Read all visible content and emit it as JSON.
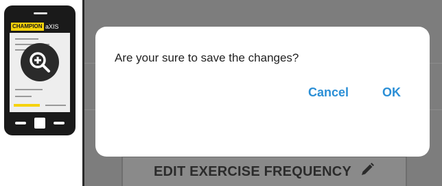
{
  "thumbnail": {
    "brand_primary": "CHAMPION",
    "brand_secondary": "aXIS",
    "zoom_icon": "zoom-in-icon",
    "accent_color": "#f5d20a"
  },
  "background": {
    "edit_frequency_label": "EDIT EXERCISE FREQUENCY",
    "edit_icon": "pencil-icon"
  },
  "dialog": {
    "message": "Are your sure to save the changes?",
    "cancel_label": "Cancel",
    "ok_label": "OK",
    "button_color": "#2b8fd6"
  }
}
